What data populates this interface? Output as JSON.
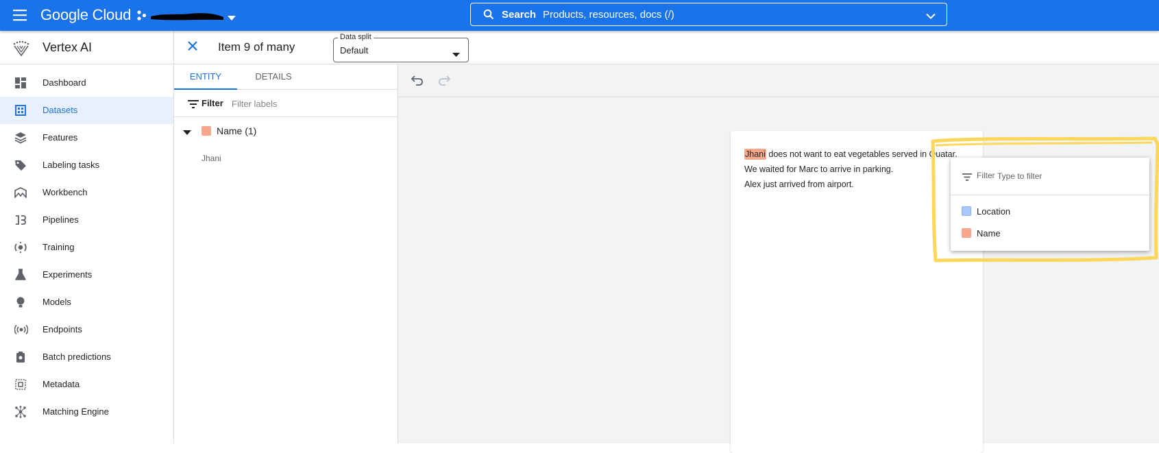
{
  "topbar": {
    "logo": "Google Cloud",
    "project_name": "",
    "search": {
      "label": "Search",
      "placeholder": "Products, resources, docs (/)"
    }
  },
  "product": {
    "name": "Vertex AI"
  },
  "sidebar": {
    "items": [
      {
        "label": "Dashboard",
        "icon": "dashboard-icon",
        "active": false
      },
      {
        "label": "Datasets",
        "icon": "datasets-icon",
        "active": true
      },
      {
        "label": "Features",
        "icon": "features-icon",
        "active": false
      },
      {
        "label": "Labeling tasks",
        "icon": "label-icon",
        "active": false
      },
      {
        "label": "Workbench",
        "icon": "workbench-icon",
        "active": false
      },
      {
        "label": "Pipelines",
        "icon": "pipelines-icon",
        "active": false
      },
      {
        "label": "Training",
        "icon": "training-icon",
        "active": false
      },
      {
        "label": "Experiments",
        "icon": "experiments-icon",
        "active": false
      },
      {
        "label": "Models",
        "icon": "models-icon",
        "active": false
      },
      {
        "label": "Endpoints",
        "icon": "endpoints-icon",
        "active": false
      },
      {
        "label": "Batch predictions",
        "icon": "batch-predictions-icon",
        "active": false
      },
      {
        "label": "Metadata",
        "icon": "metadata-icon",
        "active": false
      },
      {
        "label": "Matching Engine",
        "icon": "matching-engine-icon",
        "active": false
      }
    ]
  },
  "itembar": {
    "title": "Item 9 of many",
    "data_split": {
      "label": "Data split",
      "value": "Default"
    }
  },
  "labelpanel": {
    "tabs": [
      {
        "label": "ENTITY",
        "active": true
      },
      {
        "label": "DETAILS",
        "active": false
      }
    ],
    "filter": {
      "label": "Filter",
      "placeholder": "Filter labels"
    },
    "groups": [
      {
        "label": "Name (1)",
        "color": "#f8a88a",
        "items": [
          "Jhani"
        ]
      }
    ]
  },
  "document": {
    "lines": [
      {
        "highlight": "Jhani",
        "rest": " does not want to eat vegetables served in Quatar."
      },
      {
        "highlight": "",
        "rest": "We waited for Marc to arrive in parking."
      },
      {
        "highlight": "",
        "rest": "Alex just arrived from airport."
      }
    ]
  },
  "label_picker": {
    "filter_label": "Filter",
    "placeholder": "Type to filter",
    "options": [
      {
        "label": "Location",
        "color": "#a8c7fa"
      },
      {
        "label": "Name",
        "color": "#f8a88a"
      }
    ]
  },
  "colors": {
    "primary": "#1a73e8",
    "annotation": "#fbd75b"
  }
}
